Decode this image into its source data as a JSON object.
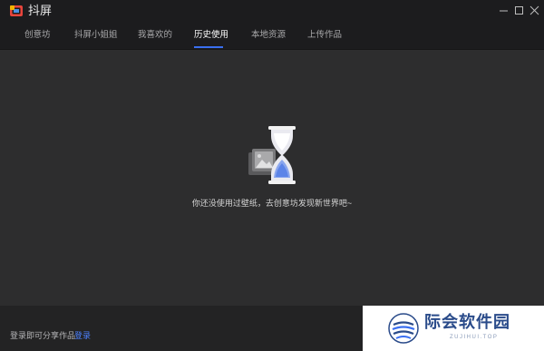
{
  "window": {
    "title": "抖屏",
    "controls": [
      "minimize-icon",
      "maximize-icon",
      "close-icon"
    ]
  },
  "tabs": [
    {
      "label": "创意坊",
      "active": false
    },
    {
      "label": "抖屏小姐姐",
      "active": false
    },
    {
      "label": "我喜欢的",
      "active": false
    },
    {
      "label": "历史使用",
      "active": true
    },
    {
      "label": "本地资源",
      "active": false
    },
    {
      "label": "上传作品",
      "active": false
    }
  ],
  "main": {
    "empty_icon": "hourglass-icon",
    "empty_message": "你还没使用过壁纸，去创意坊发现新世界吧~"
  },
  "footer": {
    "text": "登录即可分享作品",
    "login_link": "登录"
  },
  "watermark": {
    "brand_cn": "际会软件园",
    "brand_en": "ZUJIHUI.TOP"
  },
  "colors": {
    "accent": "#3a6ff0",
    "link": "#4d82ff",
    "background": "#2d2d2e",
    "titlebar": "#1c1c1e"
  }
}
